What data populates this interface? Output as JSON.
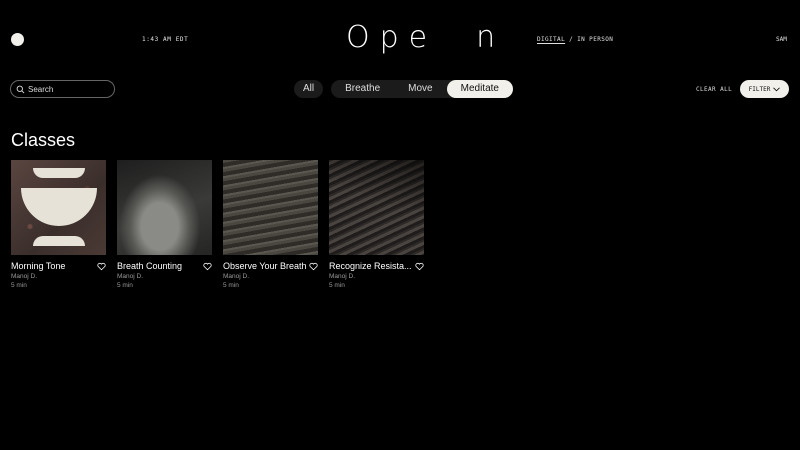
{
  "header": {
    "time": "1:43 AM EDT",
    "brand": "Ope  n",
    "mode_active": "DIGITAL",
    "mode_separator": " / ",
    "mode_other": "IN PERSON",
    "user": "SAM"
  },
  "search": {
    "placeholder": "Search"
  },
  "tabs": {
    "all": "All",
    "breathe": "Breathe",
    "move": "Move",
    "meditate": "Meditate"
  },
  "controls": {
    "clear_all": "CLEAR ALL",
    "filter": "FILTER"
  },
  "section": {
    "title": "Classes"
  },
  "cards": [
    {
      "title": "Morning Tone",
      "teacher": "Manoj D.",
      "duration": "5 min"
    },
    {
      "title": "Breath Counting",
      "teacher": "Manoj D.",
      "duration": "5 min"
    },
    {
      "title": "Observe Your Breath",
      "teacher": "Manoj D.",
      "duration": "5 min"
    },
    {
      "title": "Recognize Resista...",
      "teacher": "Manoj D.",
      "duration": "5 min"
    }
  ],
  "colors": {
    "background": "#000000",
    "pill_selected": "#f2f0ea",
    "pill": "#1b1b1b"
  }
}
